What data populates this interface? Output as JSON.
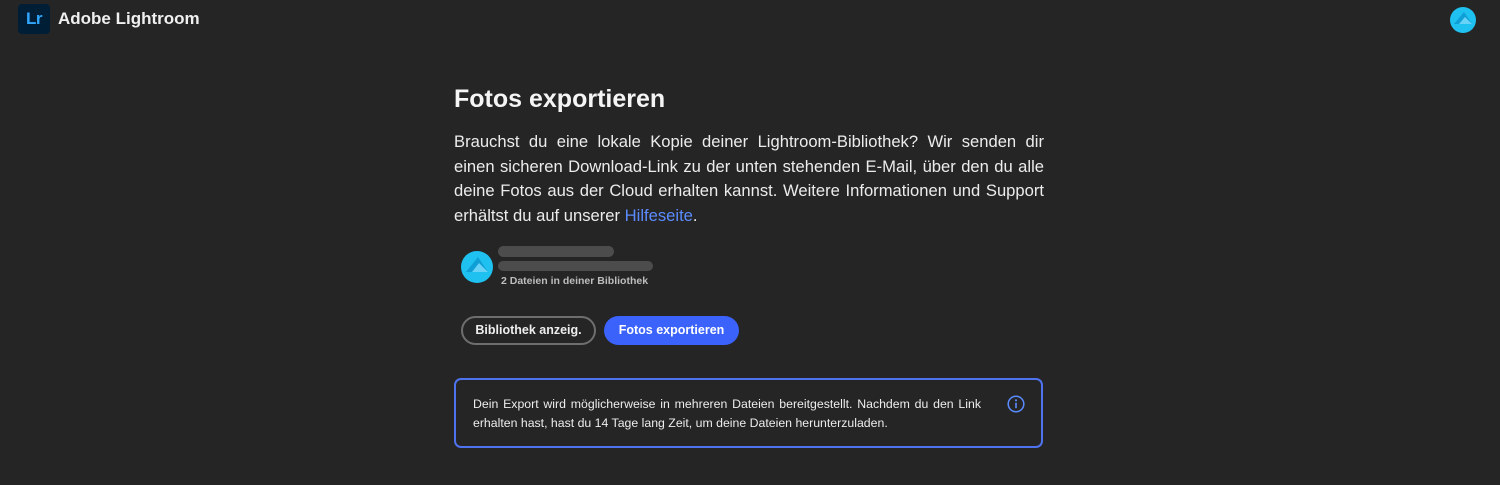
{
  "app": {
    "logo_text": "Lr",
    "title": "Adobe Lightroom"
  },
  "colors": {
    "background": "#252525",
    "accent": "#3b63fb",
    "link": "#5b8cff",
    "avatar": "#1fc1f0"
  },
  "page": {
    "title": "Fotos exportieren",
    "description_before_link": "Brauchst du eine lokale Kopie deiner Lightroom-Bibliothek? Wir senden dir einen sicheren Download-Link zu der unten stehenden E-Mail, über den du alle deine Fotos aus der Cloud erhalten kannst. Weitere Informationen und Support erhältst du auf unserer ",
    "help_link": "Hilfeseite",
    "description_after_link": "."
  },
  "account": {
    "file_count": "2 Dateien in deiner Bibliothek"
  },
  "buttons": {
    "show_library": "Bibliothek anzeig.",
    "export_photos": "Fotos exportieren"
  },
  "info": {
    "text": "Dein Export wird möglicherweise in mehreren Dateien bereitgestellt. Nachdem du den Link erhalten hast, hast du 14 Tage lang Zeit, um deine Dateien herunterzuladen.",
    "icon": "info-icon"
  }
}
